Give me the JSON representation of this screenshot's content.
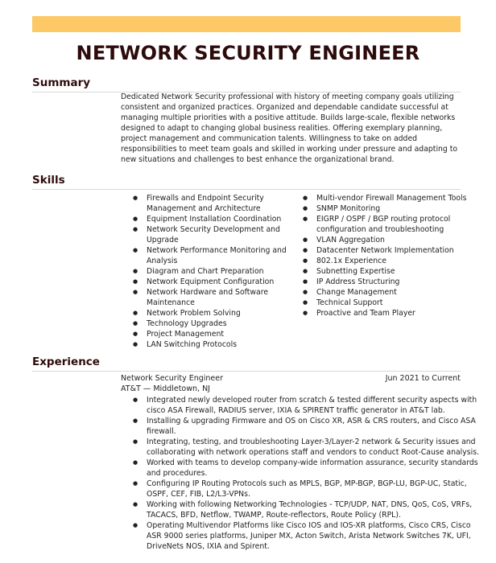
{
  "header": {
    "name": "NETWORK SECURITY ENGINEER",
    "accent_color": "#fdc866",
    "heading_color": "#2e0b0b"
  },
  "summary": {
    "heading": "Summary",
    "text": "Dedicated Network Security professional with history of meeting company goals utilizing consistent and organized practices. Organized and dependable candidate successful at managing multiple priorities with a positive attitude. Builds large-scale, flexible networks designed to adapt to changing global business realities. Offering exemplary planning, project management and communication talents. Willingness to take on added responsibilities to meet team goals and skilled in working under pressure and adapting to new situations and challenges to best enhance the organizational brand."
  },
  "skills": {
    "heading": "Skills",
    "column1": [
      "Firewalls and Endpoint Security Management and Architecture",
      "Equipment Installation Coordination",
      "Network Security Development and Upgrade",
      "Network Performance Monitoring and Analysis",
      "Diagram and Chart Preparation",
      "Network Equipment Configuration",
      "Network Hardware and Software Maintenance",
      "Network Problem Solving",
      "Technology Upgrades",
      "Project Management",
      "LAN Switching Protocols"
    ],
    "column2": [
      "Multi-vendor Firewall Management Tools",
      "SNMP Monitoring",
      "EIGRP / OSPF / BGP routing protocol configuration and troubleshooting",
      "VLAN Aggregation",
      "Datacenter Network Implementation",
      "802.1x Experience",
      "Subnetting Expertise",
      "IP Address Structuring",
      "Change Management",
      "Technical Support",
      "Proactive and Team Player"
    ]
  },
  "experience": {
    "heading": "Experience",
    "jobs": [
      {
        "title": "Network Security Engineer",
        "date": "Jun 2021 to Current",
        "company": "AT&T — Middletown, NJ",
        "bullets": [
          "Integrated newly developed router from scratch & tested different security aspects with cisco ASA Firewall, RADIUS server, IXIA & SPIRENT traffic generator in AT&T lab.",
          "Installing & upgrading Firmware and OS on Cisco XR, ASR & CRS routers, and Cisco ASA firewall.",
          "Integrating, testing, and troubleshooting Layer-3/Layer-2 network & Security issues and collaborating with network operations staff and vendors to conduct Root-Cause analysis.",
          "Worked with teams to develop company-wide information assurance, security standards and procedures.",
          "Configuring IP Routing Protocols such as MPLS, BGP, MP-BGP, BGP-LU, BGP-UC, Static, OSPF, CEF, FIB, L2/L3-VPNs.",
          "Working with following Networking Technologies - TCP/UDP, NAT, DNS, QoS, CoS, VRFs, TACACS, BFD, Netflow, TWAMP, Route-reflectors, Route Policy (RPL).",
          "Operating Multivendor Platforms like Cisco IOS and IOS-XR platforms, Cisco CRS, Cisco ASR 9000 series platforms, Juniper MX, Acton Switch, Arista Network Switches 7K, UFI, DriveNets NOS, IXIA and Spirent."
        ]
      }
    ]
  }
}
